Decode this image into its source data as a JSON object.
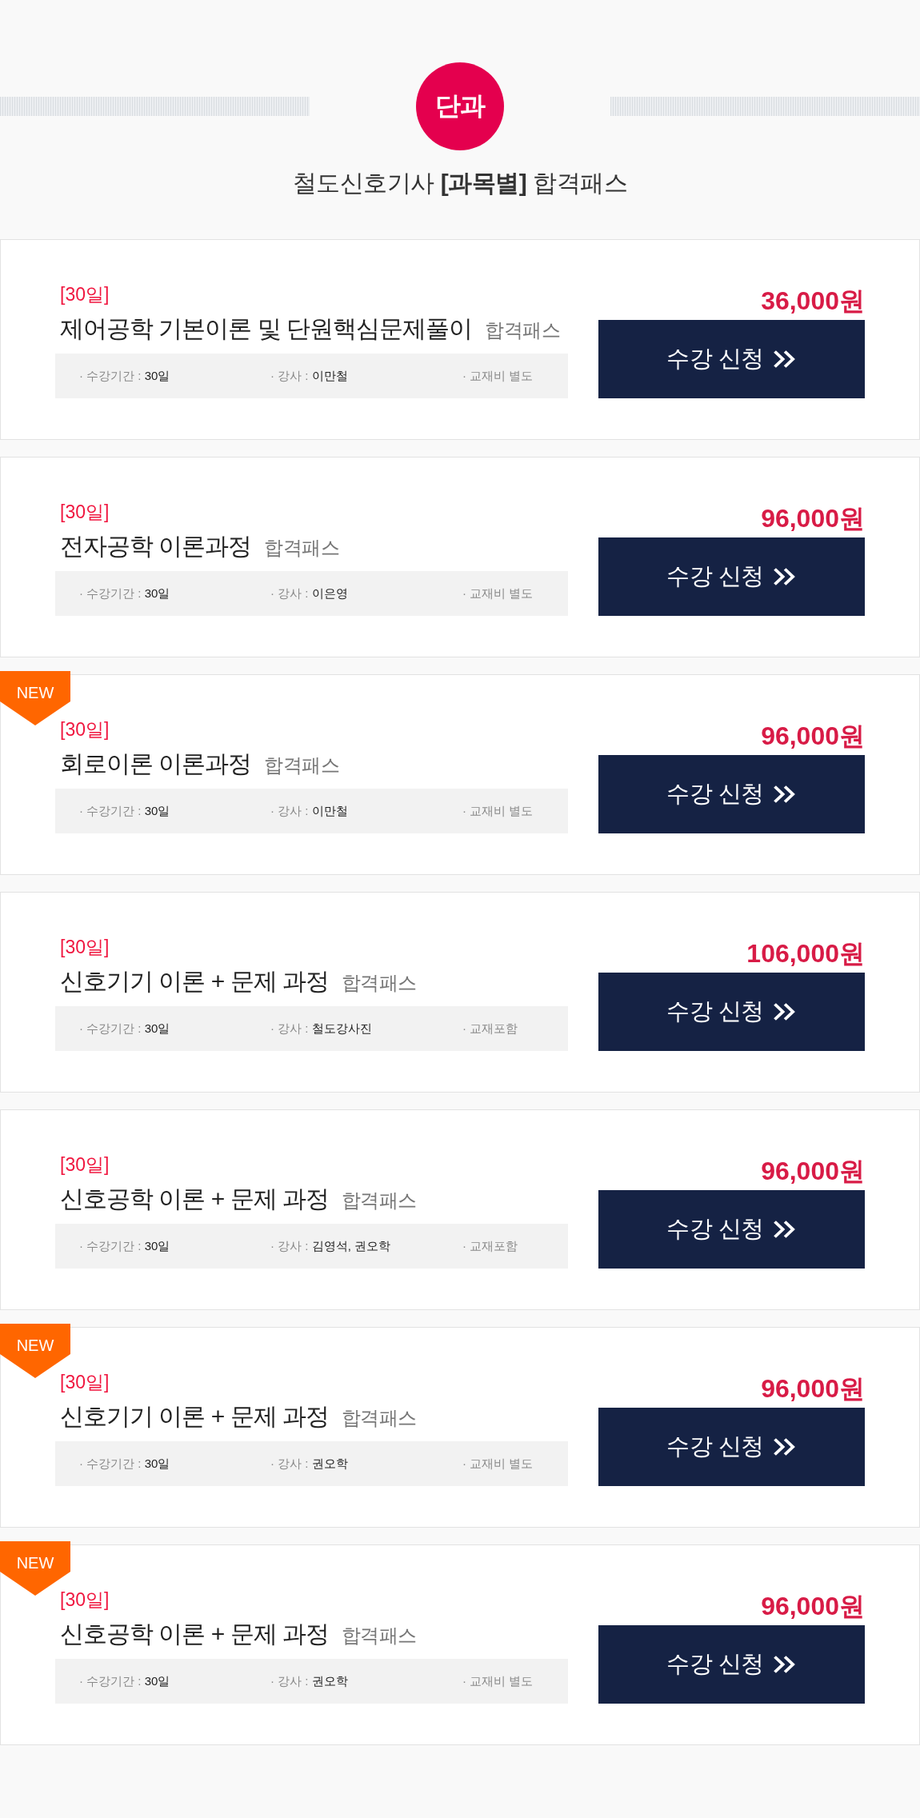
{
  "header": {
    "badge": "단과",
    "title": "철도신호기사 **[과목별]** 합격패스"
  },
  "courses": [
    {
      "period": "[30일]",
      "title": "제어공학 기본이론 및 단원핵심문제풀이",
      "pass_label": "합격패스",
      "details": [
        {
          "label": "· 수강기간 :",
          "value": "30일"
        },
        {
          "label": "· 강사 :",
          "value": "이만철"
        },
        {
          "label": "· 교재비 별도"
        }
      ],
      "price": "36,000원",
      "button": "수강 신청"
    },
    {
      "period": "[30일]",
      "title": "전자공학 이론과정",
      "pass_label": "합격패스",
      "details": [
        {
          "label": "· 수강기간 :",
          "value": "30일"
        },
        {
          "label": "· 강사 :",
          "value": "이은영"
        },
        {
          "label": "· 교재비 별도"
        }
      ],
      "price": "96,000원",
      "button": "수강 신청"
    },
    {
      "new_badge": "NEW",
      "period": "[30일]",
      "title": "회로이론 이론과정",
      "pass_label": "합격패스",
      "details": [
        {
          "label": "· 수강기간 :",
          "value": "30일"
        },
        {
          "label": "· 강사 :",
          "value": "이만철"
        },
        {
          "label": "· 교재비 별도"
        }
      ],
      "price": "96,000원",
      "button": "수강 신청"
    },
    {
      "period": "[30일]",
      "title": "신호기기 이론 + 문제 과정",
      "pass_label": "합격패스",
      "details": [
        {
          "label": "· 수강기간 :",
          "value": "30일"
        },
        {
          "label": "· 강사 :",
          "value": "철도강사진"
        },
        {
          "label": "· 교재포함"
        }
      ],
      "price": "106,000원",
      "button": "수강 신청"
    },
    {
      "period": "[30일]",
      "title": "신호공학 이론 + 문제 과정",
      "pass_label": "합격패스",
      "details": [
        {
          "label": "· 수강기간 :",
          "value": "30일"
        },
        {
          "label": "· 강사 :",
          "value": "김영석, 권오학"
        },
        {
          "label": "· 교재포함"
        }
      ],
      "price": "96,000원",
      "button": "수강 신청"
    },
    {
      "new_badge": "NEW",
      "period": "[30일]",
      "title": "신호기기 이론 + 문제 과정",
      "pass_label": "합격패스",
      "details": [
        {
          "label": "· 수강기간 :",
          "value": "30일"
        },
        {
          "label": "· 강사 :",
          "value": "권오학"
        },
        {
          "label": "· 교재비 별도"
        }
      ],
      "price": "96,000원",
      "button": "수강 신청"
    },
    {
      "new_badge": "NEW",
      "period": "[30일]",
      "title": "신호공학 이론 + 문제 과정",
      "pass_label": "합격패스",
      "details": [
        {
          "label": "· 수강기간 :",
          "value": "30일"
        },
        {
          "label": "· 강사 :",
          "value": "권오학"
        },
        {
          "label": "· 교재비 별도"
        }
      ],
      "price": "96,000원",
      "button": "수강 신청"
    }
  ]
}
